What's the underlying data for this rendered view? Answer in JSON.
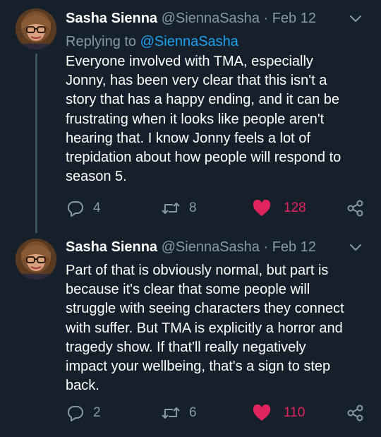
{
  "tweets": [
    {
      "name": "Sasha Sienna",
      "handle": "@SiennaSasha",
      "separator": "·",
      "date": "Feb 12",
      "reply_prefix": "Replying to",
      "reply_mention": "@SiennaSasha",
      "lines": [
        "Everyone involved with TMA, especially",
        "Jonny, has been very clear that this isn't a",
        "story that has a happy ending, and it can be",
        "frustrating when it looks like people aren't",
        "hearing that. I know Jonny feels a lot of",
        "trepidation about how people will respond to",
        "season 5."
      ],
      "replies": "4",
      "retweets": "8",
      "likes": "128",
      "liked": true,
      "icons": {
        "menu": "chevron-down-icon",
        "reply": "reply-icon",
        "retweet": "retweet-icon",
        "like": "heart-icon",
        "share": "share-icon"
      }
    },
    {
      "name": "Sasha Sienna",
      "handle": "@SiennaSasha",
      "separator": "·",
      "date": "Feb 12",
      "lines": [
        "Part of that is obviously normal, but part is",
        "because it's clear that some people will",
        "struggle with seeing characters they connect",
        "with suffer. But TMA is explicitly a horror and",
        "tragedy show. If that'll really negatively",
        "impact your wellbeing, that's a sign to step",
        "back."
      ],
      "replies": "2",
      "retweets": "6",
      "likes": "110",
      "liked": true,
      "icons": {
        "menu": "chevron-down-icon",
        "reply": "reply-icon",
        "retweet": "retweet-icon",
        "like": "heart-icon",
        "share": "share-icon"
      }
    }
  ],
  "colors": {
    "background": "#15202b",
    "text": "#ffffff",
    "muted": "#8899a6",
    "link": "#1da1f2",
    "like": "#e0245e",
    "thread_line": "#3d5466"
  }
}
